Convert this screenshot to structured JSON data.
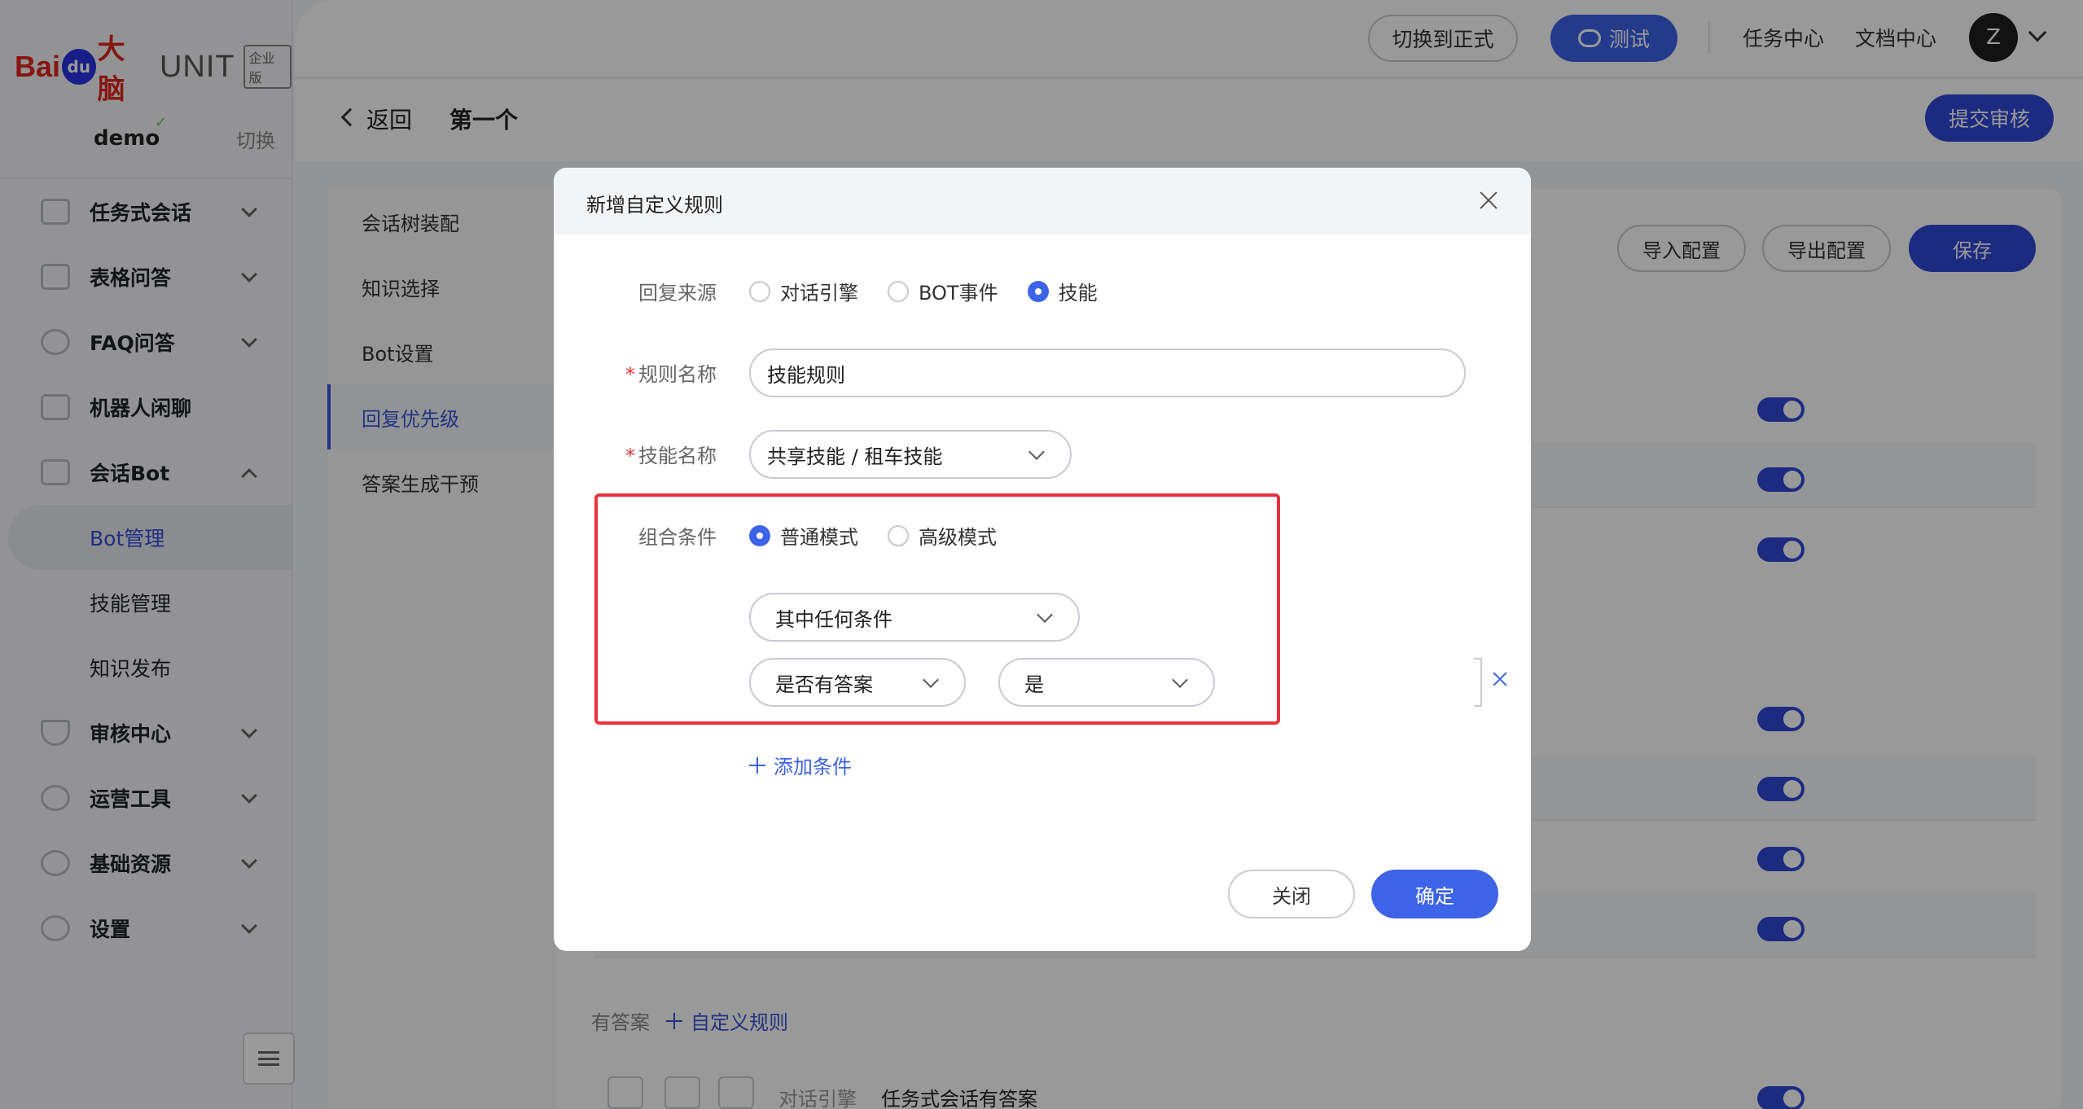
{
  "brand": {
    "bai": "Bai",
    "du": "du",
    "brain": "大脑",
    "product": "UNIT",
    "edition": "企业版"
  },
  "account": {
    "name": "demo",
    "switch_label": "切换"
  },
  "sidebar": {
    "items": [
      {
        "label": "任务式会话",
        "icon": "task-dialog-icon",
        "expanded": false
      },
      {
        "label": "表格问答",
        "icon": "table-qa-icon",
        "expanded": false
      },
      {
        "label": "FAQ问答",
        "icon": "faq-icon",
        "expanded": false
      },
      {
        "label": "机器人闲聊",
        "icon": "chat-icon"
      },
      {
        "label": "会话Bot",
        "icon": "bot-icon",
        "expanded": true,
        "children": [
          {
            "label": "Bot管理",
            "active": true
          },
          {
            "label": "技能管理"
          },
          {
            "label": "知识发布"
          }
        ]
      },
      {
        "label": "审核中心",
        "icon": "shield-icon",
        "expanded": false
      },
      {
        "label": "运营工具",
        "icon": "operations-icon",
        "expanded": false
      },
      {
        "label": "基础资源",
        "icon": "resources-icon",
        "expanded": false
      },
      {
        "label": "设置",
        "icon": "gear-icon",
        "expanded": false
      }
    ]
  },
  "topbar": {
    "switch_env": "切换到正式",
    "test": "测试",
    "task_center": "任务中心",
    "doc_center": "文档中心",
    "avatar": "Z"
  },
  "pagehead": {
    "back": "返回",
    "title": "第一个",
    "submit": "提交审核"
  },
  "subnav": {
    "items": [
      {
        "label": "会话树装配"
      },
      {
        "label": "知识选择"
      },
      {
        "label": "Bot设置"
      },
      {
        "label": "回复优先级",
        "active": true
      },
      {
        "label": "答案生成干预"
      }
    ]
  },
  "toolbar": {
    "import": "导入配置",
    "export": "导出配置",
    "save": "保存"
  },
  "background_section": {
    "label": "有答案",
    "add_rule": "自定义规则",
    "row_source": "对话引擎",
    "row_name": "任务式会话有答案"
  },
  "modal": {
    "title": "新增自定义规则",
    "reply_source": {
      "label": "回复来源",
      "options": [
        {
          "label": "对话引擎",
          "checked": false
        },
        {
          "label": "BOT事件",
          "checked": false
        },
        {
          "label": "技能",
          "checked": true
        }
      ]
    },
    "rule_name": {
      "label": "规则名称",
      "required_mark": "*",
      "value": "技能规则"
    },
    "skill_name": {
      "label": "技能名称",
      "required_mark": "*",
      "value": "共享技能 / 租车技能"
    },
    "combine": {
      "label": "组合条件",
      "options": [
        {
          "label": "普通模式",
          "checked": true
        },
        {
          "label": "高级模式",
          "checked": false
        }
      ],
      "match": "其中任何条件",
      "condition_field": "是否有答案",
      "condition_value": "是"
    },
    "add_condition": "添加条件",
    "close": "关闭",
    "confirm": "确定"
  },
  "colors": {
    "primary": "#3d63e8",
    "highlight": "#e8323c",
    "required": "#e0353b"
  }
}
